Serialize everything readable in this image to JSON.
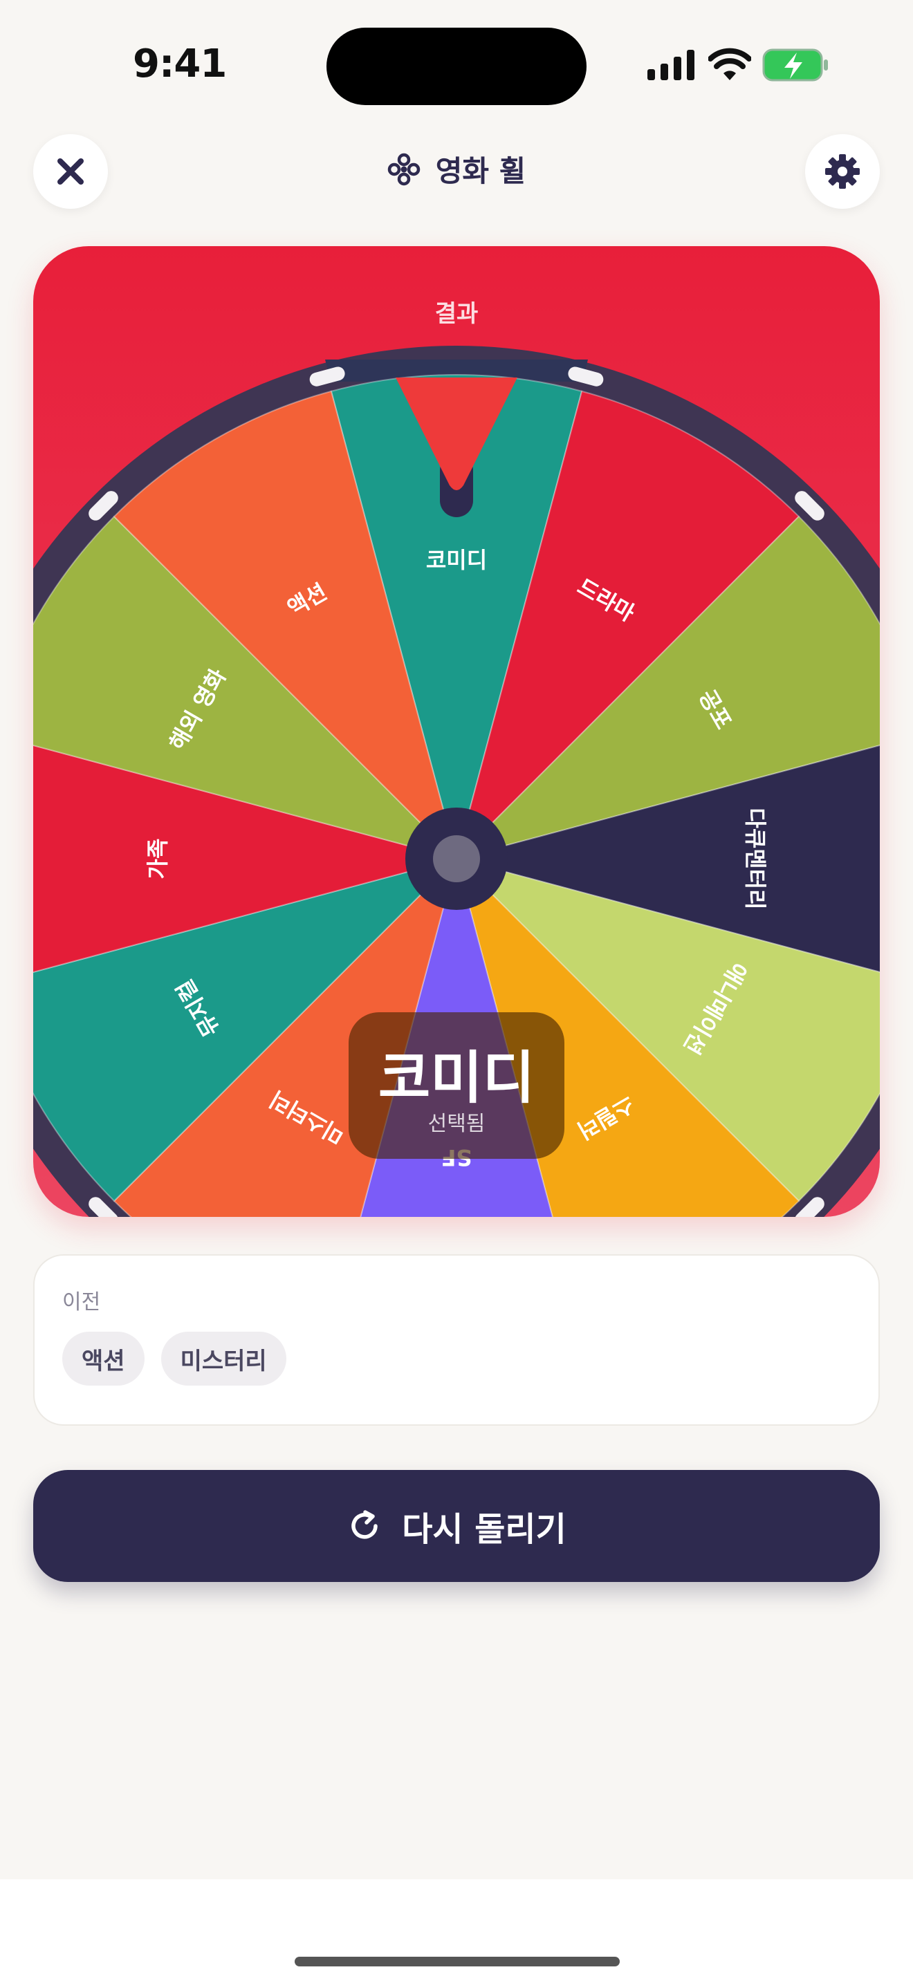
{
  "status_bar": {
    "time": "9:41"
  },
  "header": {
    "title": "영화 휠"
  },
  "wheel": {
    "result_label": "결과",
    "segments": [
      {
        "label": "코미디",
        "color": "#1b9a8a"
      },
      {
        "label": "드라마",
        "color": "#e41d38"
      },
      {
        "label": "공포",
        "color": "#9db442"
      },
      {
        "label": "다큐멘터리",
        "color": "#2e2a4f"
      },
      {
        "label": "애니메이션",
        "color": "#c4d76d"
      },
      {
        "label": "스릴러",
        "color": "#f5a713"
      },
      {
        "label": "SF",
        "color": "#7b5cf8"
      },
      {
        "label": "미스터리",
        "color": "#f36137"
      },
      {
        "label": "뮤지컬",
        "color": "#1b9a8a"
      },
      {
        "label": "가족",
        "color": "#e41d38"
      },
      {
        "label": "해외 영화",
        "color": "#9db442"
      },
      {
        "label": "액션",
        "color": "#f36137"
      }
    ],
    "selected": {
      "name": "코미디",
      "caption": "선택됨"
    }
  },
  "history": {
    "label": "이전",
    "items": [
      "액션",
      "미스터리"
    ]
  },
  "spin_button": {
    "label": "다시 돌리기"
  },
  "colors": {
    "accent": "#e81f3a",
    "primary_dark": "#2e2a4f",
    "background": "#f8f6f3",
    "battery": "#34c759"
  },
  "icons": {
    "close": "close-icon",
    "settings": "gear-icon",
    "title": "flower-icon",
    "spin": "refresh-icon"
  }
}
